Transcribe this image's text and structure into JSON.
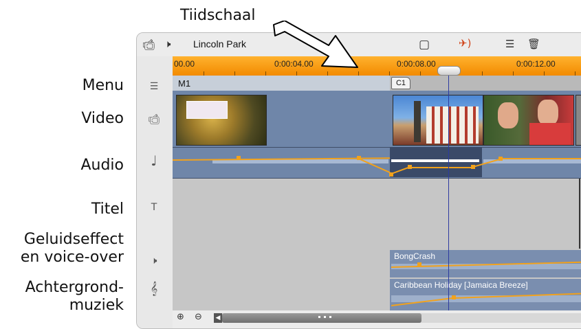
{
  "annotations": {
    "timescale": "Tiidschaal",
    "menu": "Menu",
    "video": "Video",
    "audio": "Audio",
    "title": "Titel",
    "sfx_line1": "Geluidseffect",
    "sfx_line2": "en voice-over",
    "music_line1": "Achtergrond-",
    "music_line2": "muziek"
  },
  "toolbar": {
    "project_title": "Lincoln Park",
    "icons": [
      "camcorder-icon",
      "speaker-icon",
      "marker-icon",
      "mute-audio-icon",
      "split-icon",
      "trash-icon"
    ]
  },
  "ruler": {
    "ticks": [
      "00.00",
      "0:00:04.00",
      "0:00:08.00",
      "0:00:12.00"
    ]
  },
  "menu_track": {
    "menu_label": "M1",
    "chapter_label": "C1"
  },
  "clips": {
    "sfx_clip_name": "BongCrash",
    "music_clip_name": "Caribbean Holiday [Jamaica Breeze]"
  },
  "colors": {
    "ruler": "#f28a00",
    "track": "#6f86a9",
    "volume_line": "#f2a21c",
    "playhead": "#2d3aa0"
  }
}
